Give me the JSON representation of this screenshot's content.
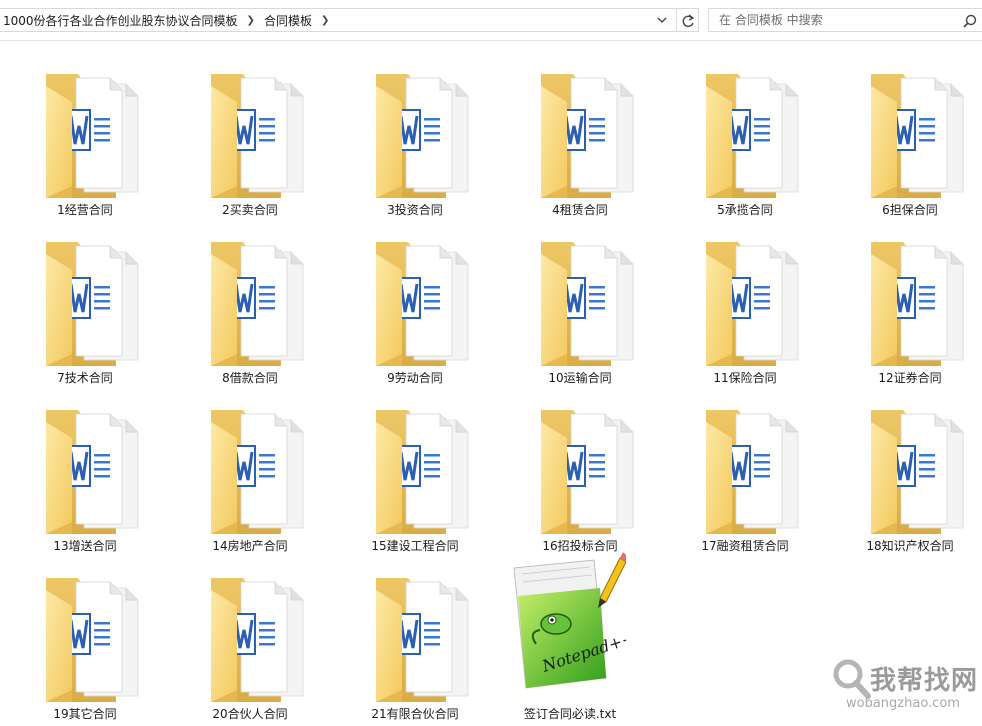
{
  "address": {
    "breadcrumbs": [
      "1000份各行各业合作创业股东协议合同模板",
      "合同模板"
    ]
  },
  "search": {
    "placeholder": "在 合同模板 中搜索"
  },
  "items": [
    {
      "name": "1经营合同"
    },
    {
      "name": "2买卖合同"
    },
    {
      "name": "3投资合同"
    },
    {
      "name": "4租赁合同"
    },
    {
      "name": "5承揽合同"
    },
    {
      "name": "6担保合同"
    },
    {
      "name": "7技术合同"
    },
    {
      "name": "8借款合同"
    },
    {
      "name": "9劳动合同"
    },
    {
      "name": "10运输合同"
    },
    {
      "name": "11保险合同"
    },
    {
      "name": "12证券合同"
    },
    {
      "name": "13增送合同"
    },
    {
      "name": "14房地产合同"
    },
    {
      "name": "15建设工程合同"
    },
    {
      "name": "16招投标合同"
    },
    {
      "name": "17融资租赁合同"
    },
    {
      "name": "18知识产权合同"
    },
    {
      "name": "19其它合同"
    },
    {
      "name": "20合伙人合同"
    },
    {
      "name": "21有限合伙合同"
    },
    {
      "name": "签订合同必读.txt"
    }
  ],
  "watermark": {
    "text": "我帮找网",
    "url": "wobangzhao.com"
  },
  "colors": {
    "folder_back": "#e9c46a",
    "folder_front": "#f8d775",
    "word_blue": "#2b5fb4"
  }
}
